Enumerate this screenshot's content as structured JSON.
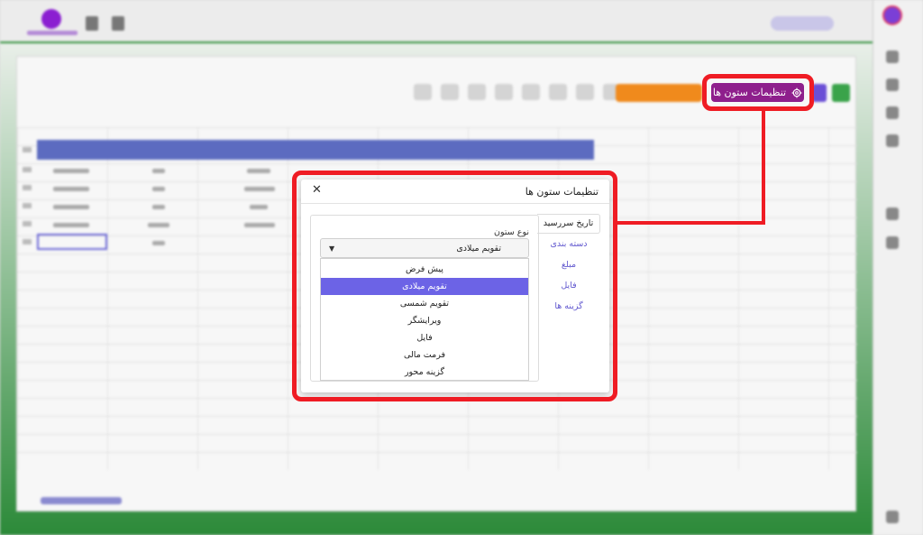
{
  "header": {
    "column_settings_label": "تنظیمات ستون ها"
  },
  "dialog": {
    "title": "تنظیمات ستون ها",
    "close_glyph": "✕",
    "tabs": [
      {
        "label": "تاریخ سررسید",
        "active": true
      },
      {
        "label": "دسته بندی",
        "active": false
      },
      {
        "label": "مبلغ",
        "active": false
      },
      {
        "label": "فایل",
        "active": false
      },
      {
        "label": "گزینه ها",
        "active": false
      }
    ],
    "column_type": {
      "label": "نوع ستون",
      "value": "تقویم میلادی",
      "caret_glyph": "▼",
      "options": [
        {
          "label": "پیش فرض",
          "selected": false
        },
        {
          "label": "تقویم میلادی",
          "selected": true
        },
        {
          "label": "تقویم شمسی",
          "selected": false
        },
        {
          "label": "ویرایشگر",
          "selected": false
        },
        {
          "label": "فایل",
          "selected": false
        },
        {
          "label": "فرمت مالی",
          "selected": false
        },
        {
          "label": "گزینه محور",
          "selected": false
        }
      ]
    }
  },
  "colors": {
    "highlight": "#ef1c24",
    "button_purple": "#8e1f8c",
    "selected_option": "#6c63e6",
    "tab_link": "#6259cf"
  }
}
